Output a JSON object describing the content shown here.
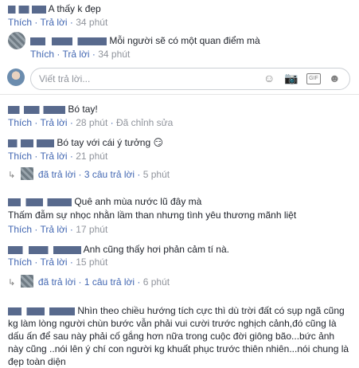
{
  "comments": [
    {
      "text": "A thấy k đẹp",
      "like": "Thích",
      "reply": "Trả lời",
      "time": "34 phút"
    },
    {
      "text": "Mỗi người sẽ có một quan điểm mà",
      "like": "Thích",
      "reply": "Trả lời",
      "time": "34 phút"
    },
    {
      "text": "Bó tay!",
      "like": "Thích",
      "reply": "Trả lời",
      "time": "28 phút",
      "edited": "Đã chỉnh sửa"
    },
    {
      "text": "Bó tay với cái ý tưởng",
      "emoji": "😏",
      "like": "Thích",
      "reply": "Trả lời",
      "time": "21 phút"
    },
    {
      "text_line1": "Quê anh mùa nước lũ đây mà",
      "text_line2": "Thấm đẫm sự nhọc nhằn lầm than nhưng tình yêu thương mãnh liệt",
      "like": "Thích",
      "reply": "Trả lời",
      "time": "17 phút"
    },
    {
      "text": "Anh cũng thấy hơi phản cảm tí nà.",
      "like": "Thích",
      "reply": "Trả lời",
      "time": "15 phút"
    },
    {
      "lines": [
        "Nhìn theo chiều hướng tích cực thì dù trời đất có sụp ngã cũng",
        "kg làm lòng người chùn bước vẫn phải vui cười trước nghịch cảnh,đó cũng là",
        "dấu ấn để sau này phải cố gắng hơn nữa trong cuộc đời giông bão...bức ảnh",
        "này cũng ..nói lên ý chí con người kg khuất phục trước thiên nhiên...nói chung là",
        "đẹp toàn diện"
      ]
    }
  ],
  "reply_input": {
    "placeholder": "Viết trả lời..."
  },
  "reply_threads": [
    {
      "replied": "đã trả lời",
      "count": "3 câu trả lời",
      "time": "5 phút"
    },
    {
      "replied": "đã trả lời",
      "count": "1 câu trả lời",
      "time": "6 phút"
    }
  ],
  "icons": [
    "emoji-icon",
    "camera-icon",
    "gif-icon",
    "sticker-icon",
    "reply-arrow-icon"
  ]
}
